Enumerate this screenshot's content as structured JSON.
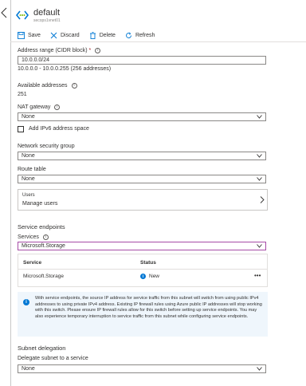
{
  "header": {
    "title": "default",
    "subtitle": "secops1vnet01"
  },
  "toolbar": {
    "save_label": "Save",
    "discard_label": "Discard",
    "delete_label": "Delete",
    "refresh_label": "Refresh"
  },
  "address_range": {
    "label": "Address range (CIDR block)",
    "required_mark": "*",
    "value": "10.0.0.0/24",
    "range_text": "10.0.0.0 - 10.0.0.255 (256 addresses)"
  },
  "available_addresses": {
    "label": "Available addresses",
    "value": "251"
  },
  "nat_gateway": {
    "label": "NAT gateway",
    "selected": "None"
  },
  "ipv6": {
    "label": "Add IPv6 address space",
    "checked": false
  },
  "nsg": {
    "label": "Network security group",
    "selected": "None"
  },
  "route_table": {
    "label": "Route table",
    "selected": "None"
  },
  "users": {
    "title": "Users",
    "link": "Manage users"
  },
  "service_endpoints": {
    "heading": "Service endpoints",
    "services_label": "Services",
    "services_selected": "Microsoft.Storage",
    "columns": [
      "Service",
      "Status"
    ],
    "rows": [
      {
        "service": "Microsoft.Storage",
        "status": "New",
        "more": "•••"
      }
    ],
    "notice": "With service endpoints, the source IP address for service traffic from this subnet will switch from using public IPv4 addresses to using private IPv4 address. Existing IP firewall rules using Azure public IP addresses will stop working with this switch. Please ensure IP firewall rules allow for this switch before setting up service endpoints. You may also experience temporary interruption to service traffic from this subnet while configuring service endpoints."
  },
  "delegation": {
    "heading": "Subnet delegation",
    "label": "Delegate subnet to a service",
    "selected": "None"
  },
  "colors": {
    "accent": "#0078d4",
    "required": "#a4262c",
    "focus_border": "#a64ca6",
    "notice_bg": "#eff6fc"
  },
  "icons": [
    "chevron-left-icon",
    "vnet-icon",
    "save-icon",
    "discard-icon",
    "delete-icon",
    "refresh-icon",
    "info-icon",
    "chevron-down-icon",
    "chevron-right-icon"
  ]
}
